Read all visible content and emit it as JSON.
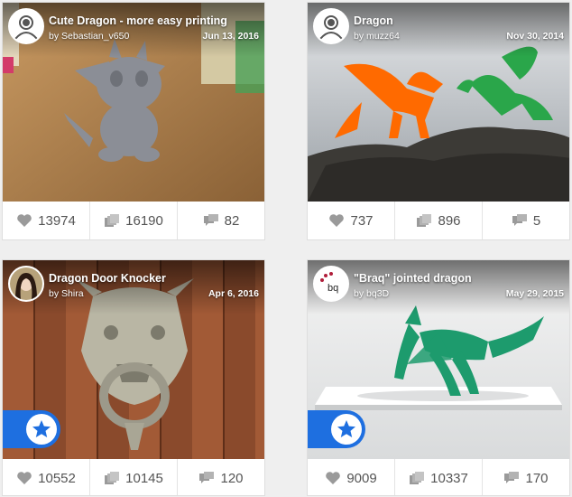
{
  "cards": [
    {
      "title": "Cute Dragon - more easy printing",
      "author": "Sebastian_v650",
      "by_prefix": "by",
      "date": "Jun 13, 2016",
      "likes": "13974",
      "collects": "16190",
      "comments": "82",
      "featured": false
    },
    {
      "title": "Dragon",
      "author": "muzz64",
      "by_prefix": "by",
      "date": "Nov 30, 2014",
      "likes": "737",
      "collects": "896",
      "comments": "5",
      "featured": false
    },
    {
      "title": "Dragon Door Knocker",
      "author": "Shira",
      "by_prefix": "by",
      "date": "Apr 6, 2016",
      "likes": "10552",
      "collects": "10145",
      "comments": "120",
      "featured": true
    },
    {
      "title": "\"Braq\" jointed dragon",
      "author": "bq3D",
      "by_prefix": "by",
      "date": "May 29, 2015",
      "likes": "9009",
      "collects": "10337",
      "comments": "170",
      "featured": true,
      "avatar_text": "bq"
    }
  ],
  "colors": {
    "featured_badge": "#1e6fe0",
    "stat_icon": "#9a9a9a",
    "stat_text": "#555555"
  },
  "icons": {
    "like": "heart-icon",
    "collect": "collection-icon",
    "comment": "comment-icon",
    "featured": "star-icon"
  }
}
